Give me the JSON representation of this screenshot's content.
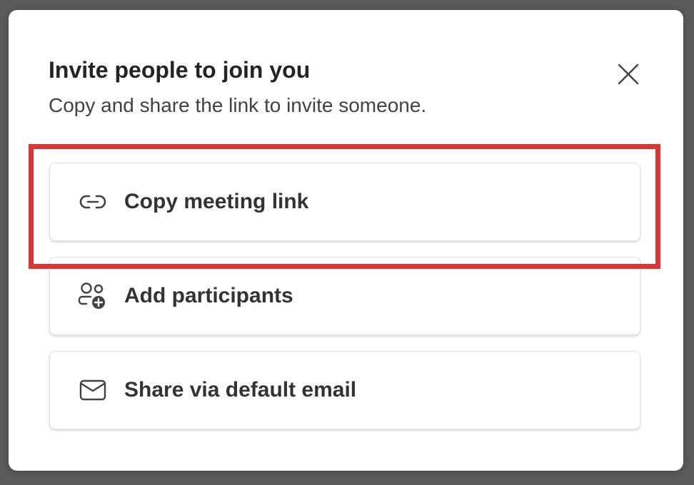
{
  "dialog": {
    "title": "Invite people to join you",
    "subtitle": "Copy and share the link to invite someone.",
    "close_icon": "close-icon"
  },
  "options": [
    {
      "label": "Copy meeting link",
      "icon": "link-icon"
    },
    {
      "label": "Add participants",
      "icon": "add-people-icon"
    },
    {
      "label": "Share via default email",
      "icon": "mail-icon"
    }
  ],
  "highlight": {
    "color": "#d93636",
    "target": "copy-meeting-link-button"
  },
  "colors": {
    "backdrop": "#5b5b5b",
    "dialog": "#ffffff",
    "text": "#242424"
  }
}
